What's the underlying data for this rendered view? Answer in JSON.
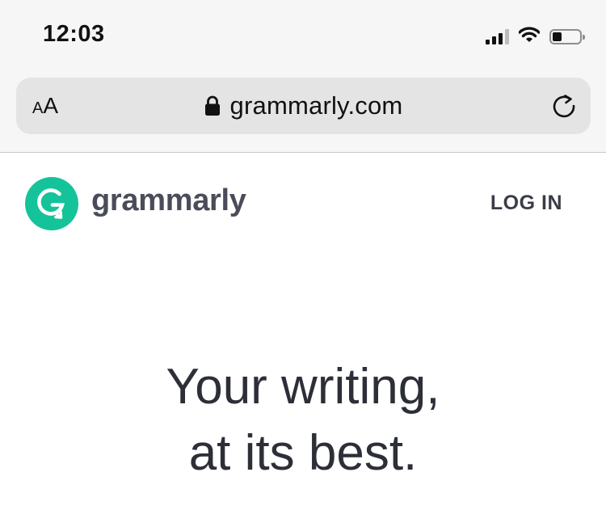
{
  "status_bar": {
    "time": "12:03",
    "icons": [
      "signal-icon",
      "wifi-icon",
      "battery-icon"
    ]
  },
  "browser": {
    "text_size_button": {
      "small": "A",
      "large": "A"
    },
    "url": "grammarly.com",
    "icons": [
      "lock-icon",
      "reload-icon"
    ]
  },
  "site": {
    "logo_text": "grammarly",
    "login_label": "LOG IN",
    "brand_color": "#15c39a"
  },
  "hero": {
    "line1": "Your writing,",
    "line2": "at its best."
  }
}
